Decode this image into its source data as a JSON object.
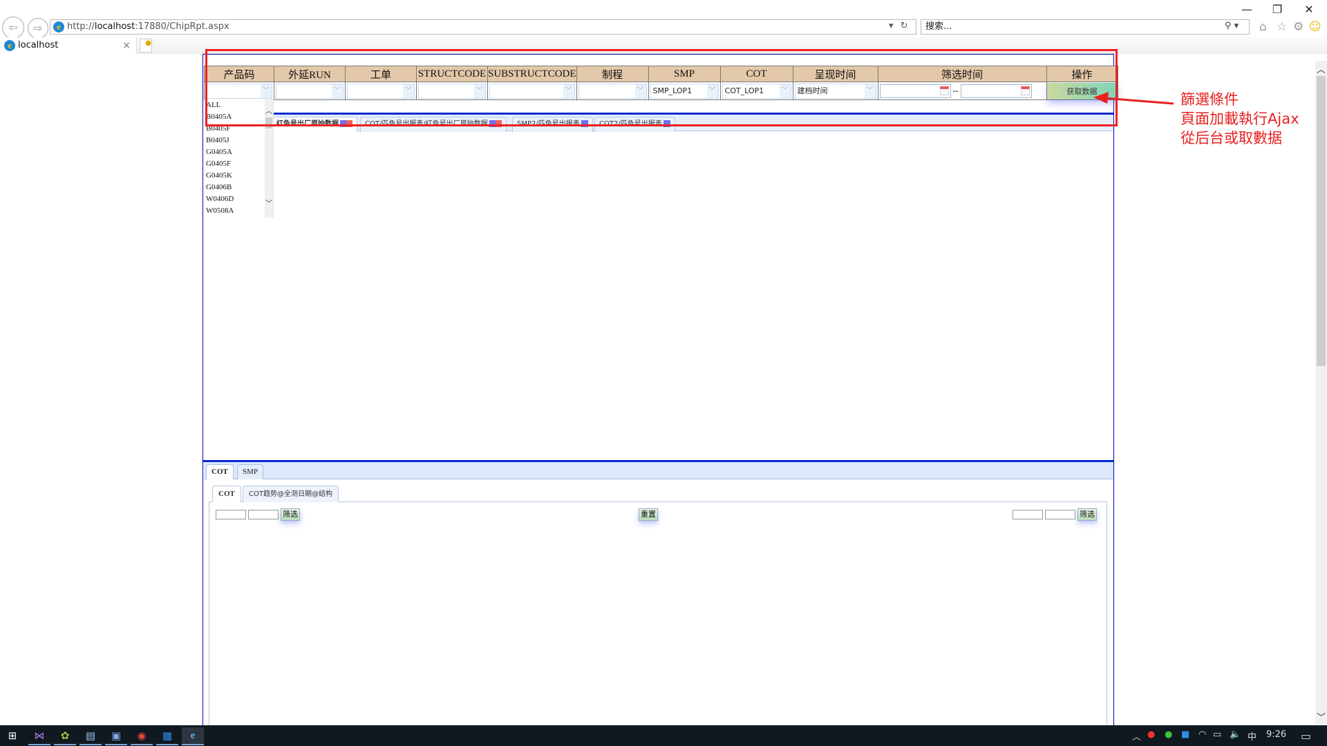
{
  "window": {
    "controls": {
      "minimize": "—",
      "restore": "❐",
      "close": "✕"
    }
  },
  "browser": {
    "url_prefix": "http://",
    "url_host": "localhost",
    "url_rest": ":17880/ChipRpt.aspx",
    "search_placeholder": "搜索...",
    "tab_title": "localhost",
    "tab_close": "×",
    "icons": [
      "back-icon",
      "forward-icon",
      "refresh-icon",
      "search-icon",
      "home-icon",
      "favorites-star-icon",
      "settings-gear-icon",
      "feedback-smiley-icon"
    ]
  },
  "filters": {
    "headers": [
      "产品码",
      "外延RUN",
      "工单",
      "STRUCTCODE",
      "SUBSTRUCTCODE",
      "制程",
      "SMP",
      "COT",
      "呈现时间",
      "筛选时间",
      "操作"
    ],
    "selects": [
      {
        "name": "product-code",
        "value": ""
      },
      {
        "name": "epi-run",
        "value": ""
      },
      {
        "name": "work-order",
        "value": ""
      },
      {
        "name": "structcode",
        "value": ""
      },
      {
        "name": "substructcode",
        "value": ""
      },
      {
        "name": "process",
        "value": ""
      },
      {
        "name": "smp",
        "value": "SMP_LOP1"
      },
      {
        "name": "cot",
        "value": "COT_LOP1"
      },
      {
        "name": "display-time",
        "value": "建档时间"
      }
    ],
    "date_from": "",
    "date_to": "",
    "date_separator": "--",
    "get_data_button": "获取数据"
  },
  "product_dropdown": {
    "options": [
      "ALL",
      "B0405A",
      "B0405F",
      "B0405J",
      "G0405A",
      "G0405F",
      "G0405K",
      "G0406B",
      "W0406D",
      "W0508A"
    ]
  },
  "upper_tabs": [
    {
      "label": "红色号出厂原始数据",
      "active": true
    },
    {
      "label": "COT/匹色号出报表/红色号出厂原始数据",
      "active": false
    },
    {
      "label": "SMP2/匹色号出报表",
      "active": false
    },
    {
      "label": "COT2/匹色号出报表",
      "active": false
    }
  ],
  "annotation": {
    "lines": [
      "篩選條件",
      "頁面加載執行Ajax",
      "從后台或取數据"
    ],
    "color": "#e82020"
  },
  "bottom": {
    "tabs": [
      "COT",
      "SMP"
    ],
    "active_tab": "COT",
    "inner_tabs": [
      "COT",
      "COT趋势@全测日期@结构"
    ],
    "left_filter_button": "筛选",
    "reset_button": "重置",
    "right_filter_button": "筛选"
  },
  "taskbar": {
    "apps": [
      "windows-start",
      "visual-studio",
      "android-tool",
      "notepad",
      "remote-desktop",
      "chrome",
      "store",
      "internet-explorer"
    ],
    "tray_ime": "中",
    "clock": "9:26"
  }
}
